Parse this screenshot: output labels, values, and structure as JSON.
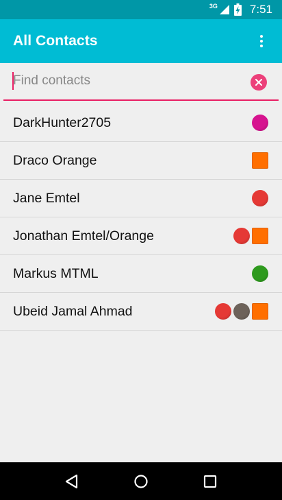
{
  "status_bar": {
    "network": "3G",
    "time": "7:51",
    "icons": [
      "signal-icon",
      "battery-charging-icon"
    ]
  },
  "app_bar": {
    "title": "All Contacts",
    "menu_icon": "overflow-menu-icon"
  },
  "search": {
    "placeholder": "Find contacts",
    "value": "",
    "clear_icon": "clear-icon",
    "accent_color": "#e91e63"
  },
  "contacts": [
    {
      "name": "DarkHunter2705",
      "markers": [
        {
          "shape": "circle",
          "color": "#d6138f"
        }
      ]
    },
    {
      "name": "Draco Orange",
      "markers": [
        {
          "shape": "square",
          "color": "#ff6f00"
        }
      ]
    },
    {
      "name": "Jane Emtel",
      "markers": [
        {
          "shape": "circle",
          "color": "#e53935"
        }
      ]
    },
    {
      "name": "Jonathan Emtel/Orange",
      "markers": [
        {
          "shape": "circle",
          "color": "#e53935"
        },
        {
          "shape": "square",
          "color": "#ff6f00"
        }
      ]
    },
    {
      "name": "Markus MTML",
      "markers": [
        {
          "shape": "circle",
          "color": "#2e9a1e"
        }
      ]
    },
    {
      "name": "Ubeid Jamal Ahmad",
      "markers": [
        {
          "shape": "circle",
          "color": "#e53935"
        },
        {
          "shape": "circle",
          "color": "#6d625a"
        },
        {
          "shape": "square",
          "color": "#ff6f00"
        }
      ]
    }
  ],
  "nav_bar": {
    "icons": [
      "back-icon",
      "home-icon",
      "recents-icon"
    ]
  },
  "colors": {
    "status_bar": "#0097a7",
    "app_bar": "#00bcd4",
    "background": "#efefef"
  }
}
